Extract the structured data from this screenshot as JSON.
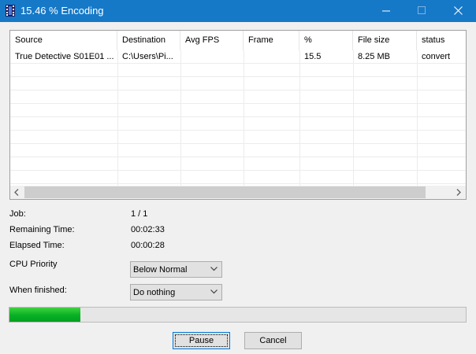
{
  "window": {
    "title": "15.46 % Encoding",
    "app_icon": "film-strip-icon",
    "controls": {
      "minimize": "minimize-icon",
      "maximize": "maximize-icon",
      "close": "close-icon"
    }
  },
  "table": {
    "columns": [
      "Source",
      "Destination",
      "Avg FPS",
      "Frame",
      "%",
      "File size",
      "status"
    ],
    "rows": [
      [
        "True Detective S01E01 ...",
        "C:\\Users\\Pi...",
        "",
        "",
        "15.5",
        "8.25 MB",
        "convert"
      ]
    ]
  },
  "info": {
    "job_label": "Job:",
    "job_value": "1 / 1",
    "remaining_label": "Remaining Time:",
    "remaining_value": "00:02:33",
    "elapsed_label": "Elapsed Time:",
    "elapsed_value": "00:00:28"
  },
  "cpu_priority": {
    "label": "CPU Priority",
    "value": "Below Normal"
  },
  "when_finished": {
    "label": "When finished:",
    "value": "Do nothing"
  },
  "progress": {
    "percent": 15.46
  },
  "buttons": {
    "pause": "Pause",
    "cancel": "Cancel"
  },
  "colors": {
    "titlebar": "#1679c8",
    "progress_fill": "#06b025",
    "default_button_border": "#0078d7"
  }
}
